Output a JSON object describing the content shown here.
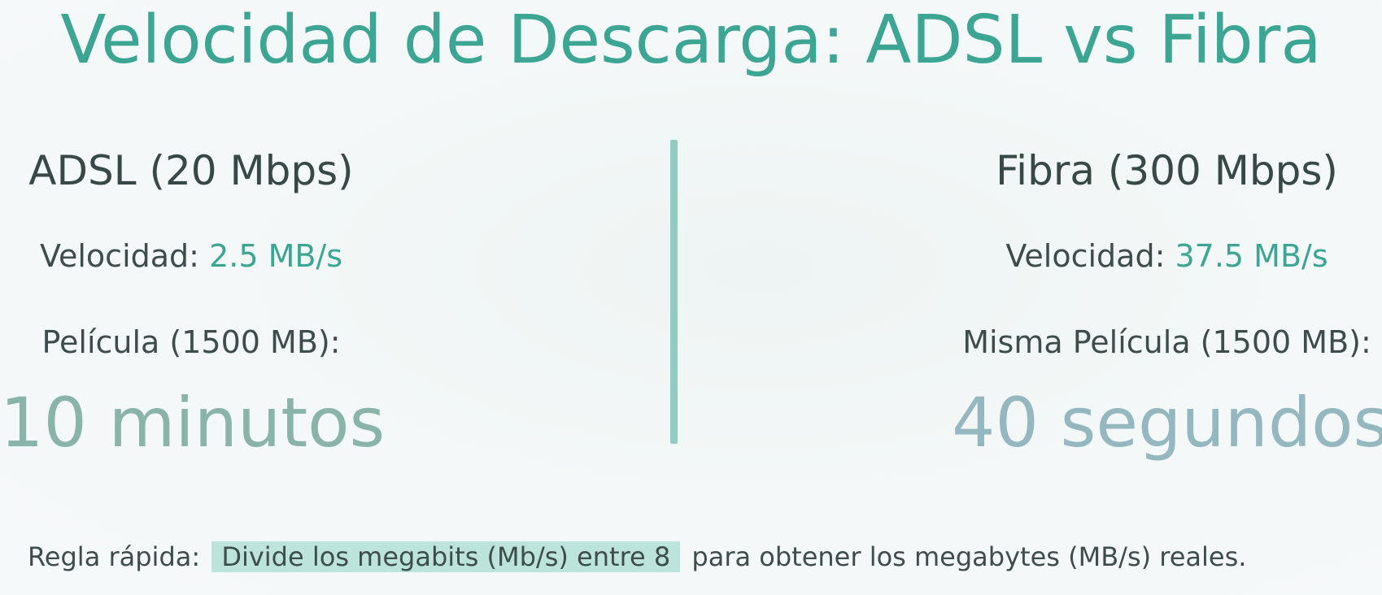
{
  "title": "Velocidad de Descarga: ADSL vs Fibra",
  "colors": {
    "accent": "#3da593",
    "text": "#3e4d4b",
    "divider": "#93cbc3",
    "highlight": "#bce3dc"
  },
  "adsl": {
    "heading": "ADSL (20 Mbps)",
    "speed_label": "Velocidad:",
    "speed_value": "2.5 MB/s",
    "movie_label": "Película (1500 MB):",
    "time": "10 minutos"
  },
  "fibra": {
    "heading": "Fibra (300 Mbps)",
    "speed_label": "Velocidad:",
    "speed_value": "37.5 MB/s",
    "movie_label": "Misma Película (1500 MB):",
    "time": "40 segundos"
  },
  "footer": {
    "prefix": "Regla rápida:",
    "highlight": "Divide los megabits (Mb/s) entre 8",
    "suffix": "para obtener los megabytes (MB/s) reales."
  }
}
